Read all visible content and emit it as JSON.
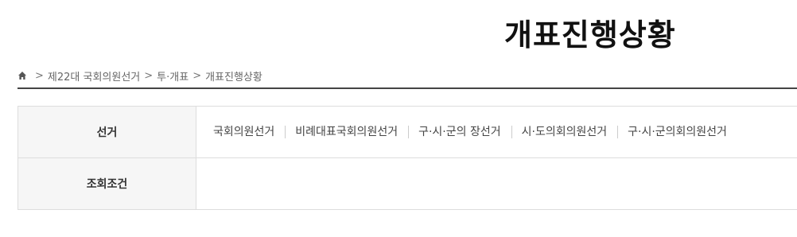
{
  "page_title": "개표진행상황",
  "breadcrumb": {
    "home_icon": "home-icon",
    "separator": ">",
    "items": [
      "제22대 국회의원선거",
      "투·개표",
      "개표진행상황"
    ]
  },
  "search": {
    "election_label": "선거",
    "election_tabs": [
      "국회의원선거",
      "비례대표국회의원선거",
      "구·시·군의 장선거",
      "시·도의회의원선거",
      "구·시·군의회의원선거"
    ],
    "condition_label": "조회조건"
  },
  "colors": {
    "title": "#111111",
    "rule": "#444444",
    "table_border": "#dddddd",
    "header_bg": "#f6f6f6"
  }
}
